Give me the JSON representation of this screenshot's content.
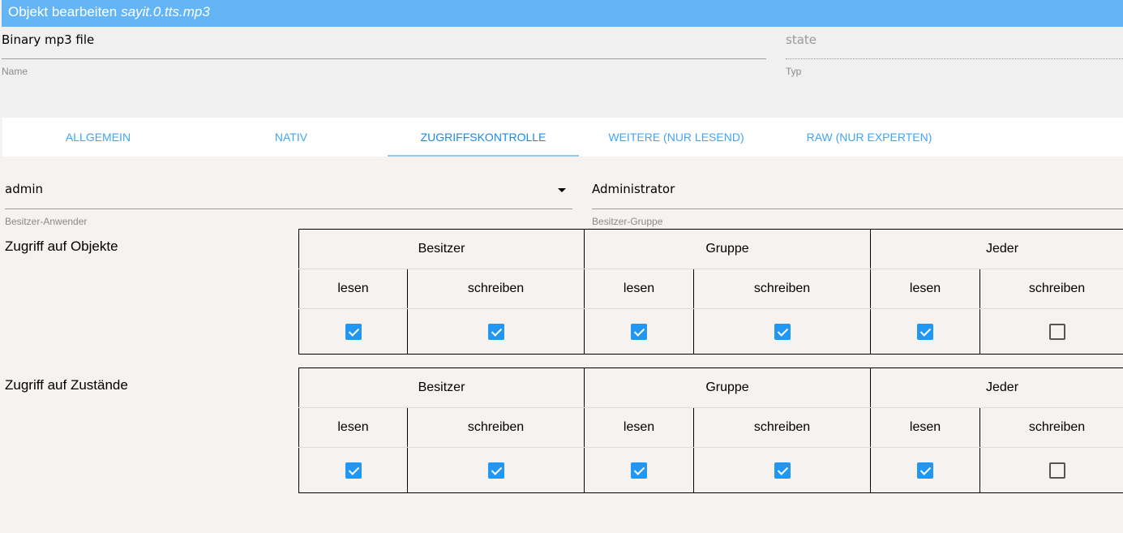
{
  "title": {
    "prefix": "Objekt bearbeiten",
    "object_id": "sayit.0.tts.mp3"
  },
  "name_field": {
    "value": "Binary mp3 file",
    "label": "Name"
  },
  "type_field": {
    "value": "state",
    "label": "Typ"
  },
  "tabs": [
    {
      "label": "ALLGEMEIN",
      "active": false
    },
    {
      "label": "NATIV",
      "active": false
    },
    {
      "label": "ZUGRIFFSKONTROLLE",
      "active": true
    },
    {
      "label": "WEITERE (NUR LESEND)",
      "active": false
    },
    {
      "label": "RAW (NUR EXPERTEN)",
      "active": false
    }
  ],
  "owner_user": {
    "value": "admin",
    "label": "Besitzer-Anwender"
  },
  "owner_group": {
    "value": "Administrator",
    "label": "Besitzer-Gruppe"
  },
  "groups": [
    "Besitzer",
    "Gruppe",
    "Jeder"
  ],
  "permissions": [
    "lesen",
    "schreiben"
  ],
  "sections": [
    {
      "title": "Zugriff auf Objekte",
      "checked": [
        true,
        true,
        true,
        true,
        true,
        false
      ]
    },
    {
      "title": "Zugriff auf Zustände",
      "checked": [
        true,
        true,
        true,
        true,
        true,
        false
      ]
    }
  ]
}
